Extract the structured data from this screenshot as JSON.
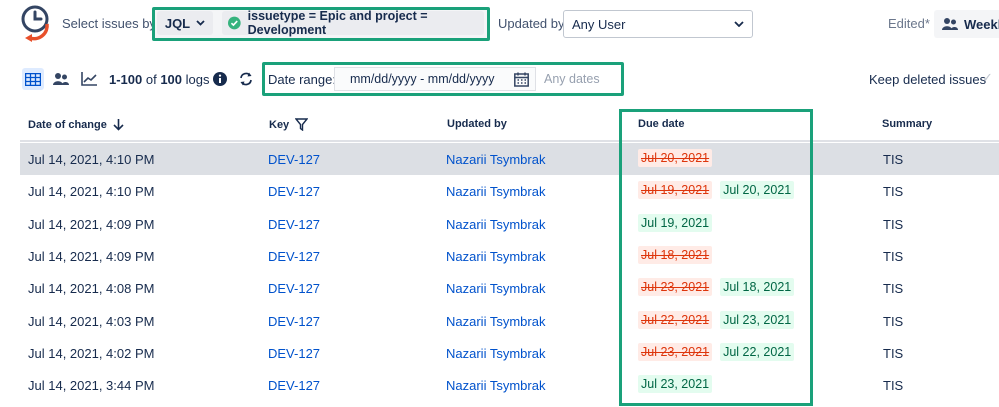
{
  "toolbar": {
    "select_label": "Select issues by:",
    "mode_label": "JQL",
    "query_text": "issuetype = Epic and project = Development",
    "updated_by_label": "Updated by:",
    "updated_by_value": "Any User",
    "edited_label": "Edited*",
    "weekly_label": "Weekly"
  },
  "subbar": {
    "logs_range": "1-100",
    "logs_of": " of ",
    "logs_total": "100",
    "logs_suffix": " logs",
    "date_range_label": "Date range:",
    "date_placeholder": "mm/dd/yyyy - mm/dd/yyyy",
    "any_dates": "Any dates",
    "keep_deleted": "Keep deleted issues",
    "keep_check": "✓"
  },
  "table": {
    "headers": [
      "Date of change",
      "Key",
      "Updated by",
      "Due date",
      "Summary"
    ],
    "rows": [
      {
        "date": "Jul 14, 2021, 4:10 PM",
        "key": "DEV-127",
        "user": "Nazarii Tsymbrak",
        "old_due": "Jul 20, 2021",
        "new_due": "",
        "summary": "TIS"
      },
      {
        "date": "Jul 14, 2021, 4:10 PM",
        "key": "DEV-127",
        "user": "Nazarii Tsymbrak",
        "old_due": "Jul 19, 2021",
        "new_due": "Jul 20, 2021",
        "summary": "TIS"
      },
      {
        "date": "Jul 14, 2021, 4:09 PM",
        "key": "DEV-127",
        "user": "Nazarii Tsymbrak",
        "old_due": "",
        "new_due": "Jul 19, 2021",
        "summary": "TIS"
      },
      {
        "date": "Jul 14, 2021, 4:09 PM",
        "key": "DEV-127",
        "user": "Nazarii Tsymbrak",
        "old_due": "Jul 18, 2021",
        "new_due": "",
        "summary": "TIS"
      },
      {
        "date": "Jul 14, 2021, 4:08 PM",
        "key": "DEV-127",
        "user": "Nazarii Tsymbrak",
        "old_due": "Jul 23, 2021",
        "new_due": "Jul 18, 2021",
        "summary": "TIS"
      },
      {
        "date": "Jul 14, 2021, 4:03 PM",
        "key": "DEV-127",
        "user": "Nazarii Tsymbrak",
        "old_due": "Jul 22, 2021",
        "new_due": "Jul 23, 2021",
        "summary": "TIS"
      },
      {
        "date": "Jul 14, 2021, 4:02 PM",
        "key": "DEV-127",
        "user": "Nazarii Tsymbrak",
        "old_due": "Jul 23, 2021",
        "new_due": "Jul 22, 2021",
        "summary": "TIS"
      },
      {
        "date": "Jul 14, 2021, 3:44 PM",
        "key": "DEV-127",
        "user": "Nazarii Tsymbrak",
        "old_due": "",
        "new_due": "Jul 23, 2021",
        "summary": "TIS"
      }
    ]
  },
  "colors": {
    "highlight_frame": "#1aa17a",
    "link": "#0052cc",
    "removed_bg": "#ffebe6",
    "added_bg": "#e3fcef"
  }
}
